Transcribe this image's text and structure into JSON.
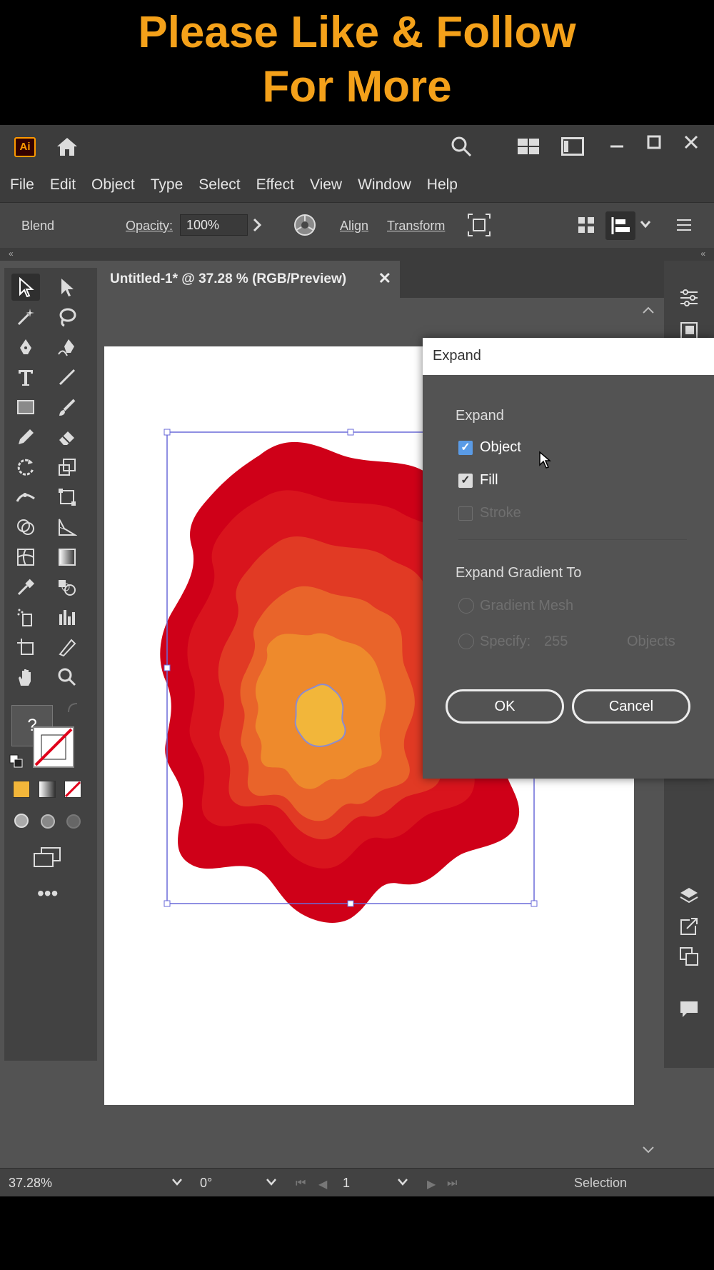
{
  "banner": {
    "line1": "Please Like & Follow",
    "line2": "For More"
  },
  "app": {
    "logo": "Ai"
  },
  "menu": [
    "File",
    "Edit",
    "Object",
    "Type",
    "Select",
    "Effect",
    "View",
    "Window",
    "Help"
  ],
  "control": {
    "mode": "Blend",
    "opacity_label": "Opacity:",
    "opacity_value": "100%",
    "align": "Align",
    "transform": "Transform"
  },
  "document": {
    "tab_title": "Untitled-1* @ 37.28 % (RGB/Preview)",
    "close": "✕"
  },
  "toolbar": {
    "fill_help": "?"
  },
  "status": {
    "zoom": "37.28%",
    "rotation": "0°",
    "artboard": "1",
    "tool": "Selection"
  },
  "dialog": {
    "title": "Expand",
    "section1": "Expand",
    "object": "Object",
    "fill": "Fill",
    "stroke": "Stroke",
    "section2": "Expand Gradient To",
    "gradient_mesh": "Gradient Mesh",
    "specify": "Specify:",
    "specify_value": "255",
    "objects": "Objects",
    "ok": "OK",
    "cancel": "Cancel",
    "object_checked": true,
    "fill_checked": true,
    "stroke_checked": false
  },
  "colors": {
    "banner_text": "#f4a11a",
    "blob_outer": "#cf0018",
    "blob_2": "#d9141d",
    "blob_3": "#e13a24",
    "blob_4": "#e9642a",
    "blob_5": "#ee8a2c",
    "blob_core": "#f2b63a",
    "selection": "#6a6ad8"
  }
}
